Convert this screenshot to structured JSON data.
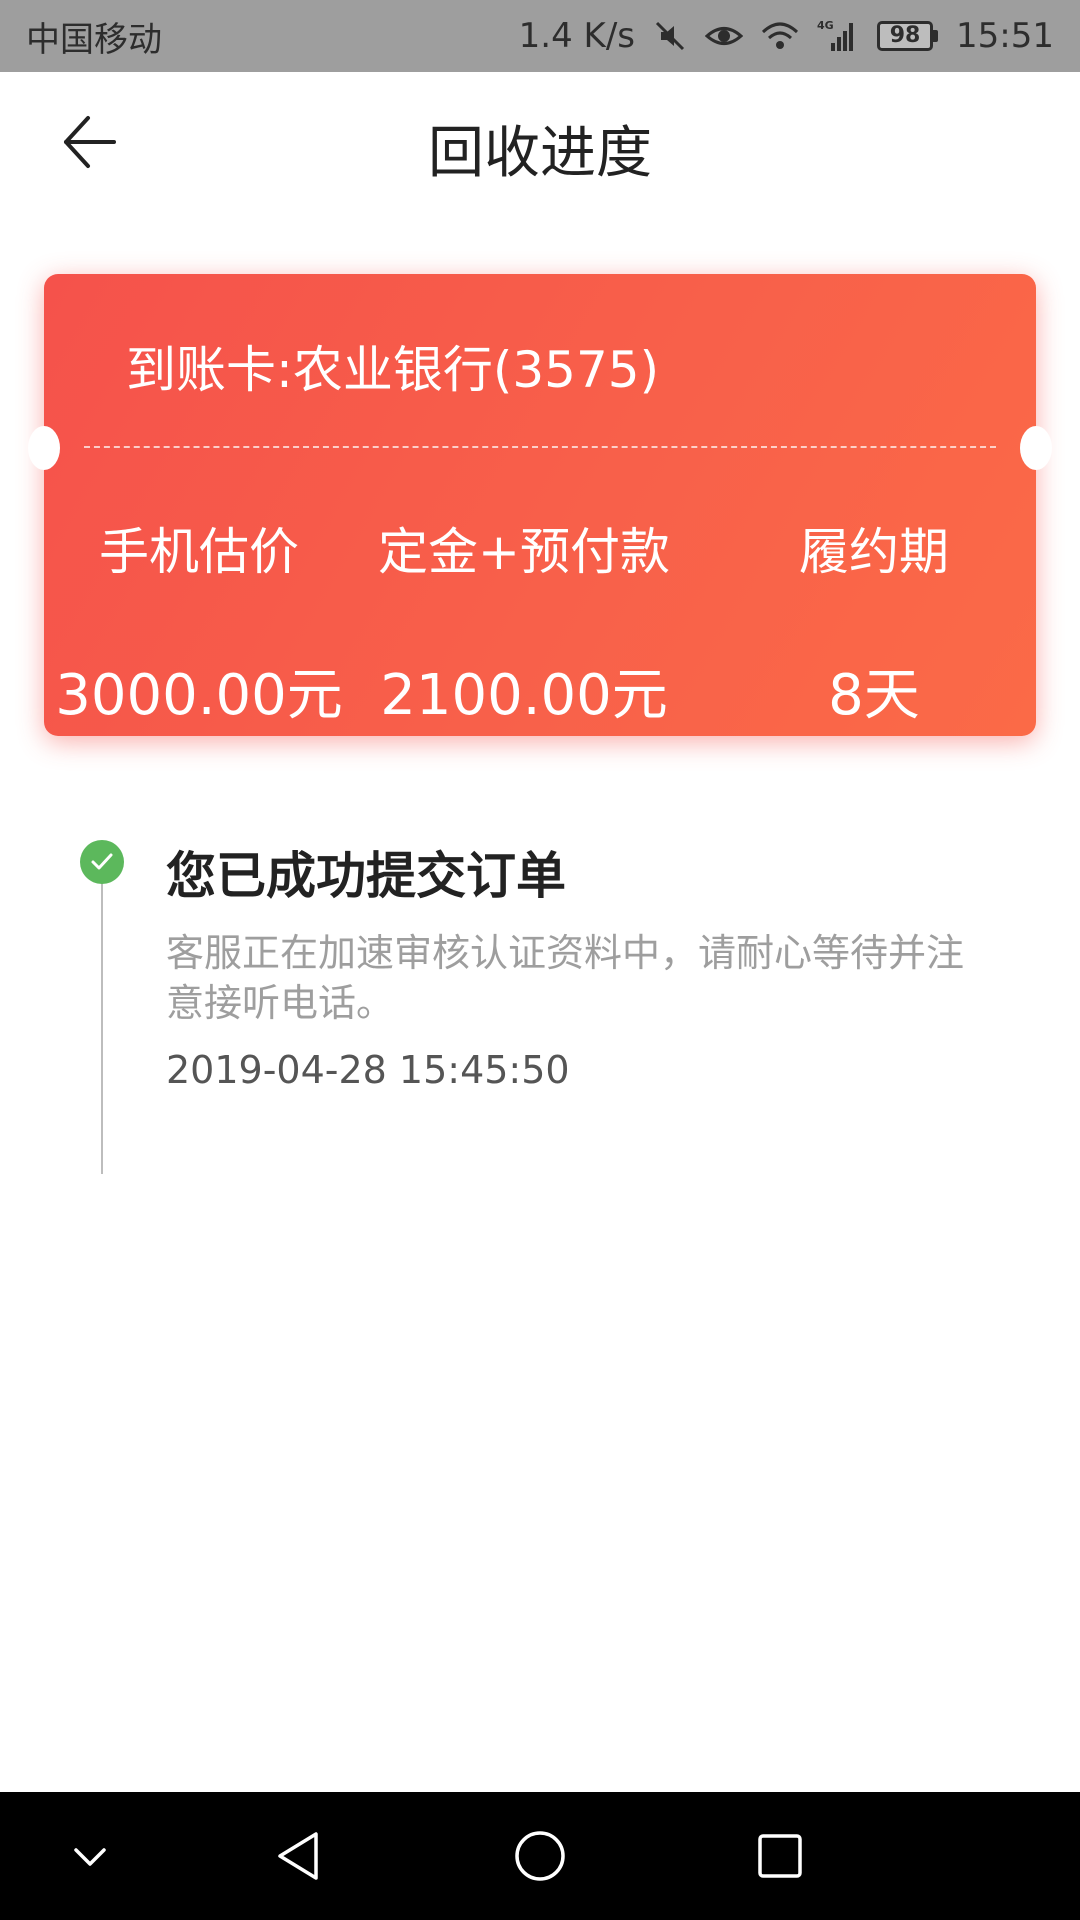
{
  "status_bar": {
    "carrier": "中国移动",
    "speed": "1.4 K/s",
    "network": "4G",
    "battery": "98",
    "time": "15:51"
  },
  "header": {
    "title": "回收进度"
  },
  "card": {
    "title": "到账卡:农业银行(3575)",
    "columns": [
      {
        "label": "手机估价",
        "value": "3000.00元"
      },
      {
        "label": "定金+预付款",
        "value": "2100.00元"
      },
      {
        "label": "履约期",
        "value": "8天"
      }
    ],
    "colors": {
      "start": "#f5524b",
      "end": "#fb6a47"
    }
  },
  "timeline": {
    "items": [
      {
        "title": "您已成功提交订单",
        "description": "客服正在加速审核认证资料中，请耐心等待并注意接听电话。",
        "time": "2019-04-28 15:45:50",
        "status_color": "#5cb85c"
      }
    ]
  }
}
